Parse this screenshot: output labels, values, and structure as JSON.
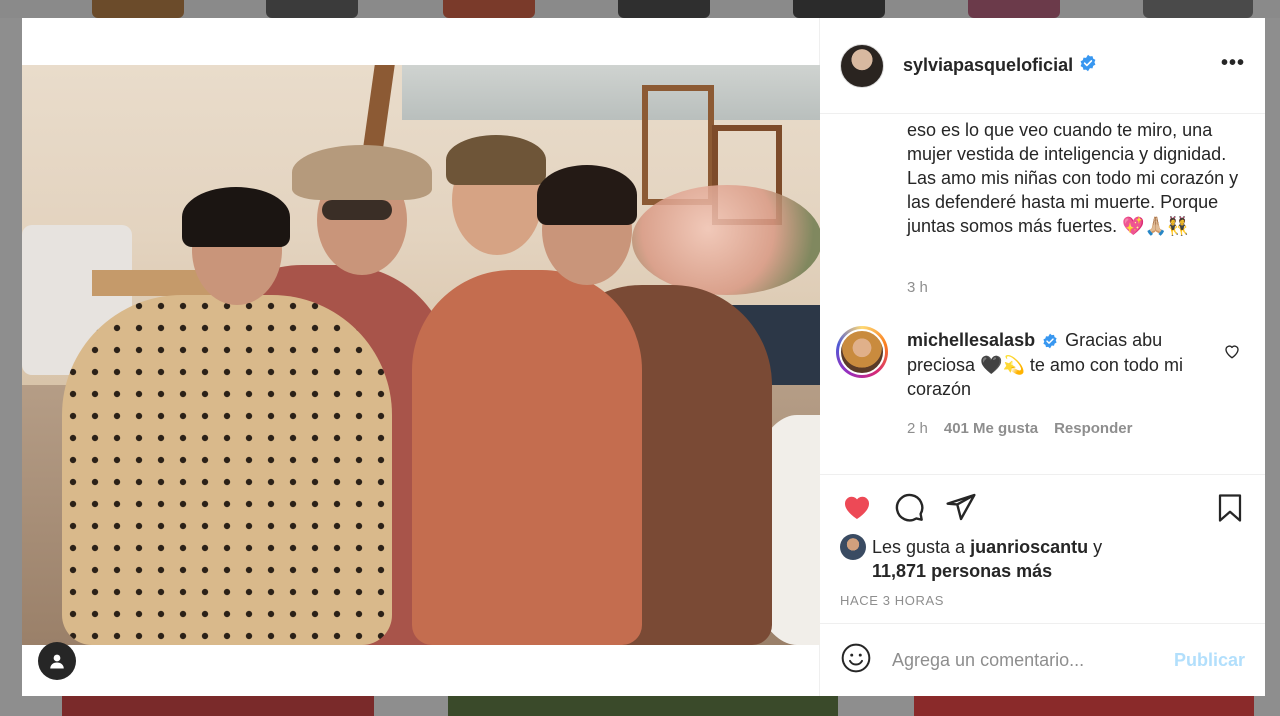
{
  "post": {
    "owner": "sylviapasqueloficial",
    "caption": "eso es lo que veo cuando te miro, una mujer vestida de inteligencia y dignidad. Las amo mis niñas con todo mi corazón y las defenderé hasta mi muerte. Porque juntas somos más fuertes. 💖🙏🏼👯",
    "caption_time": "3 h",
    "more_icon": "more-horizontal-icon"
  },
  "reply": {
    "username": "michellesalasb",
    "text": "Gracias abu preciosa 🖤💫 te amo con todo mi corazón",
    "time": "2 h",
    "likes": "401 Me gusta",
    "reply_label": "Responder"
  },
  "likes": {
    "prefix": "Les gusta a",
    "user": "juanrioscantu",
    "conj": "y",
    "count_text": "11,871 personas más"
  },
  "ago": "HACE 3 HORAS",
  "composer": {
    "placeholder": "Agrega un comentario...",
    "publish": "Publicar"
  },
  "colors": {
    "heart": "#ed4956",
    "verified": "#3897f0",
    "publish_disabled": "#b2dffc"
  }
}
